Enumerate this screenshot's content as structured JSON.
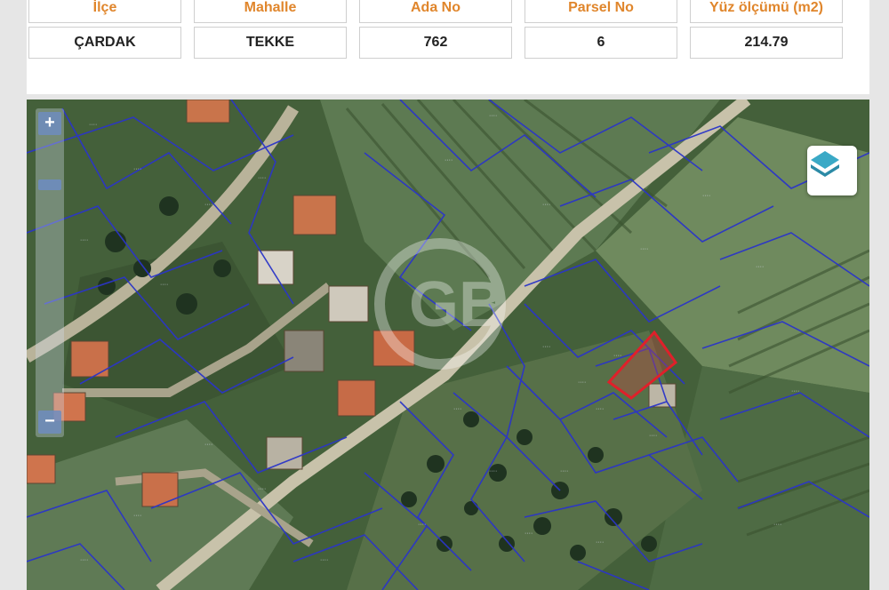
{
  "parcel_table": {
    "headers": [
      "İlçe",
      "Mahalle",
      "Ada No",
      "Parsel No",
      "Yüz ölçümü (m2)"
    ],
    "values": [
      "ÇARDAK",
      "TEKKE",
      "762",
      "6",
      "214.79"
    ]
  },
  "map": {
    "zoom_in_label": "+",
    "zoom_out_label": "−",
    "layer_icon": "layers-icon",
    "watermark_logo": "GB",
    "colors": {
      "parcel_border": "#2b35c8",
      "highlight_parcel": "#e0202a",
      "header_text": "#e0862c"
    }
  }
}
